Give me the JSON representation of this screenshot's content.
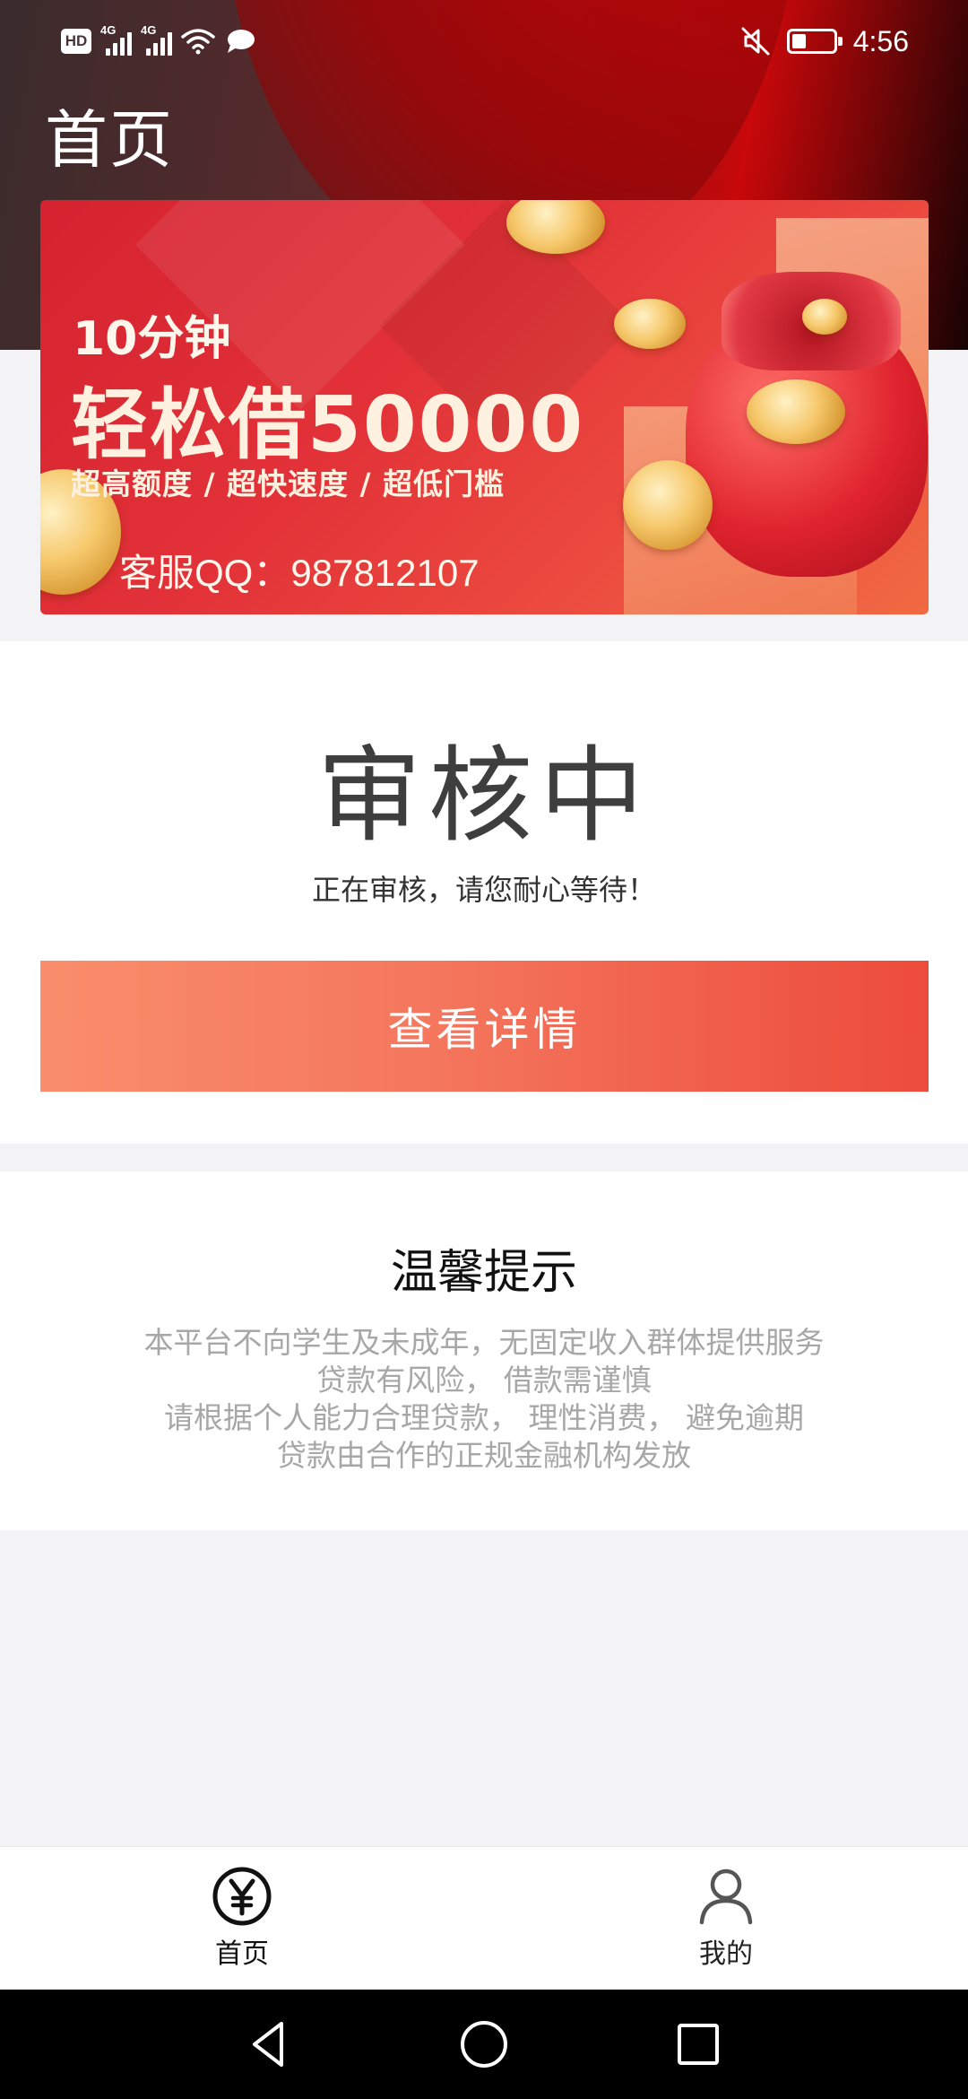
{
  "status_bar": {
    "hd": "HD",
    "net1": "4G",
    "net2": "4G",
    "time": "4:56",
    "battery_level": 0.35,
    "icons": [
      "hd-icon",
      "signal-icon",
      "signal-icon",
      "wifi-icon",
      "message-icon",
      "mute-icon",
      "battery-icon"
    ]
  },
  "page": {
    "title": "首页"
  },
  "banner": {
    "line1": "10分钟",
    "line2": "轻松借50000",
    "tagline": "超高额度 / 超快速度 / 超低门槛",
    "contact": "客服QQ：987812107"
  },
  "status_card": {
    "title": "审核中",
    "subtitle": "正在审核，请您耐心等待！",
    "button_label": "查看详情"
  },
  "tips": {
    "title": "温馨提示",
    "lines": [
      "本平台不向学生及未成年，无固定收入群体提供服务",
      "贷款有风险， 借款需谨慎",
      "请根据个人能力合理贷款， 理性消费， 避免逾期",
      "贷款由合作的正规金融机构发放"
    ]
  },
  "tab_bar": {
    "tabs": [
      {
        "label": "首页",
        "icon": "yen-circle-icon",
        "active": true
      },
      {
        "label": "我的",
        "icon": "person-icon",
        "active": false
      }
    ]
  },
  "nav_bar": {
    "icons": [
      "back-triangle-icon",
      "home-circle-icon",
      "recents-square-icon"
    ]
  },
  "colors": {
    "button_start": "#f98d6c",
    "button_end": "#ed4b3c",
    "header_dark": "#3a2b2c",
    "header_red": "#c8080a",
    "tip_text": "#a7a7a7"
  }
}
